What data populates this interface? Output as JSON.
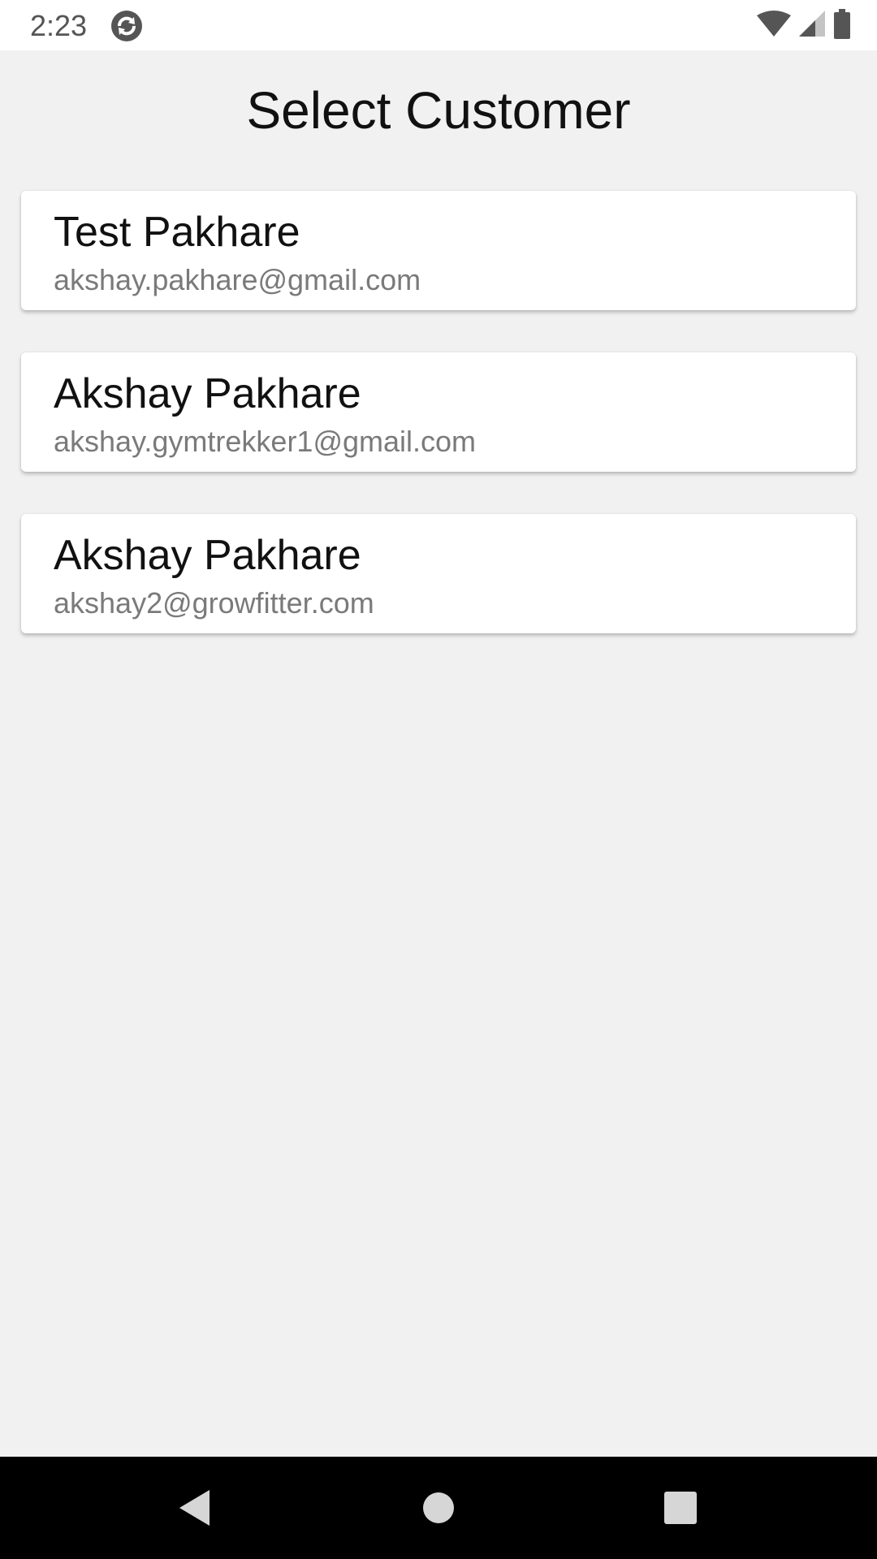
{
  "status_bar": {
    "time": "2:23",
    "icons": [
      "sync-icon",
      "wifi-icon",
      "signal-icon",
      "battery-icon"
    ]
  },
  "page": {
    "title": "Select Customer"
  },
  "customers": [
    {
      "name": "Test Pakhare",
      "email": "akshay.pakhare@gmail.com"
    },
    {
      "name": "Akshay Pakhare",
      "email": "akshay.gymtrekker1@gmail.com"
    },
    {
      "name": "Akshay Pakhare",
      "email": "akshay2@growfitter.com"
    }
  ],
  "nav_bar": {
    "icons": [
      "back-icon",
      "home-icon",
      "recents-icon"
    ]
  },
  "colors": {
    "background": "#f1f1f1",
    "card": "#ffffff",
    "email_text": "#7a7a7a",
    "nav_bar": "#000000"
  }
}
